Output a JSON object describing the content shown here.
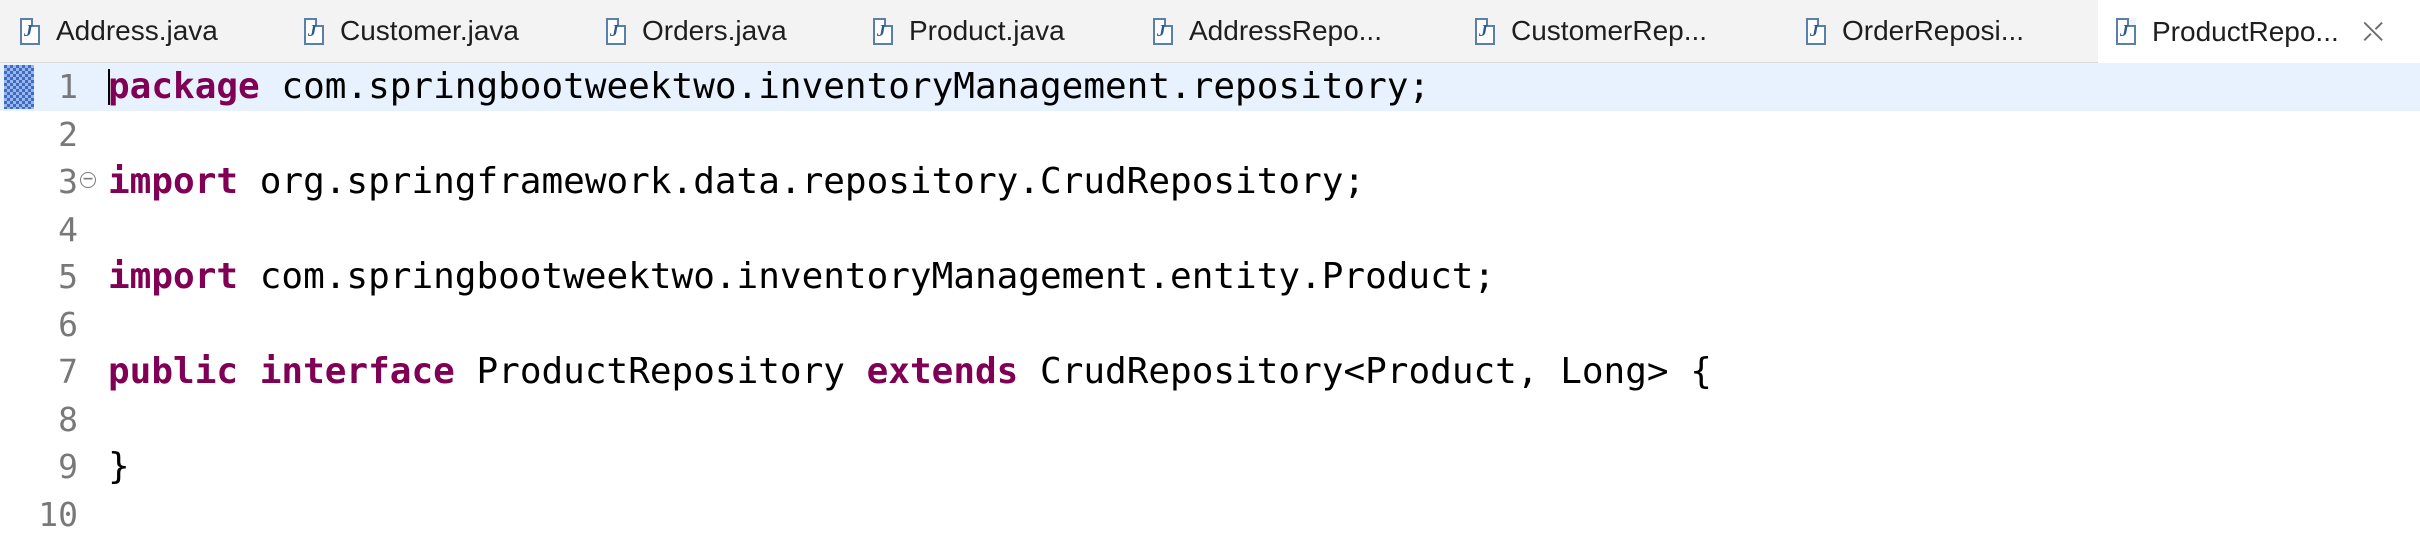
{
  "tabs": [
    {
      "label": "Address.java",
      "icon": "java-file-icon"
    },
    {
      "label": "Customer.java",
      "icon": "java-file-icon"
    },
    {
      "label": "Orders.java",
      "icon": "java-file-icon"
    },
    {
      "label": "Product.java",
      "icon": "java-file-icon"
    },
    {
      "label": "AddressRepo...",
      "icon": "java-file-icon"
    },
    {
      "label": "CustomerRep...",
      "icon": "java-file-icon"
    },
    {
      "label": "OrderReposi...",
      "icon": "java-file-icon"
    },
    {
      "label": "ProductRepo...",
      "icon": "java-file-icon",
      "active": true,
      "close_glyph": "⛌"
    }
  ],
  "editor": {
    "lines": [
      {
        "num": "1",
        "kw": "package",
        "rest": " com.springbootweektwo.inventoryManagement.repository;"
      },
      {
        "num": "2",
        "kw": "",
        "rest": ""
      },
      {
        "num": "3",
        "kw": "import",
        "rest": " org.springframework.data.repository.CrudRepository;"
      },
      {
        "num": "4",
        "kw": "",
        "rest": ""
      },
      {
        "num": "5",
        "kw": "import",
        "rest": " com.springbootweektwo.inventoryManagement.entity.Product;"
      },
      {
        "num": "6",
        "kw": "",
        "rest": ""
      },
      {
        "num": "7",
        "kw1": "public",
        "kw2": "interface",
        "mid": " ProductRepository ",
        "kw3": "extends",
        "rest": " CrudRepository<Product, Long> {"
      },
      {
        "num": "8",
        "kw": "",
        "rest": ""
      },
      {
        "num": "9",
        "kw": "",
        "rest": "}"
      },
      {
        "num": "10",
        "kw": "",
        "rest": ""
      }
    ],
    "fold_glyph": "−",
    "colors": {
      "keyword": "#7f0055",
      "current_line": "#e8f2fe",
      "line_number": "#787878"
    }
  }
}
